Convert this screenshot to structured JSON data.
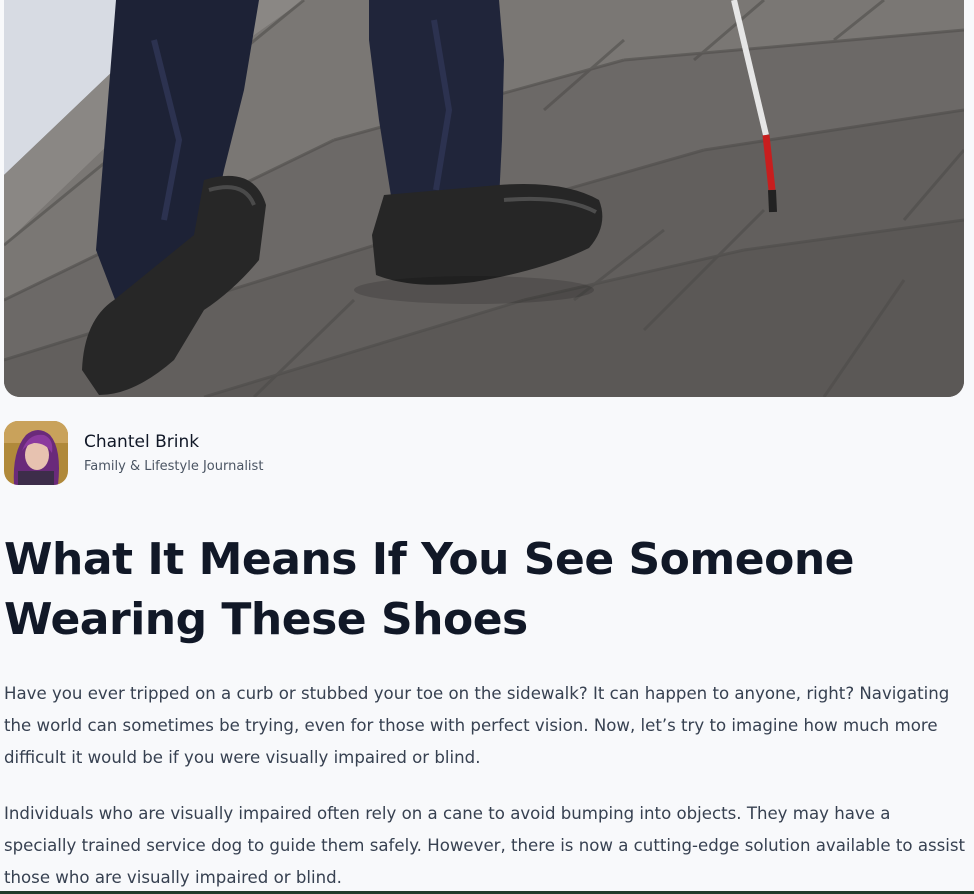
{
  "article": {
    "hero_image_name": "person-with-white-cane-on-stairs",
    "author": {
      "name": "Chantel Brink",
      "role": "Family & Lifestyle Journalist"
    },
    "title": "What It Means If You See Someone Wearing These Shoes",
    "paragraphs": [
      "Have you ever tripped on a curb or stubbed your toe on the sidewalk? It can happen to anyone, right? Navigating the world can sometimes be trying, even for those with perfect vision. Now, let’s try to imagine how much more difficult it would be if you were visually impaired or blind.",
      "Individuals who are visually impaired often rely on a cane to avoid bumping into objects. They may have a specially trained service dog to guide them safely. However, there is now a cutting-edge solution available to assist those who are visually impaired or blind."
    ]
  }
}
